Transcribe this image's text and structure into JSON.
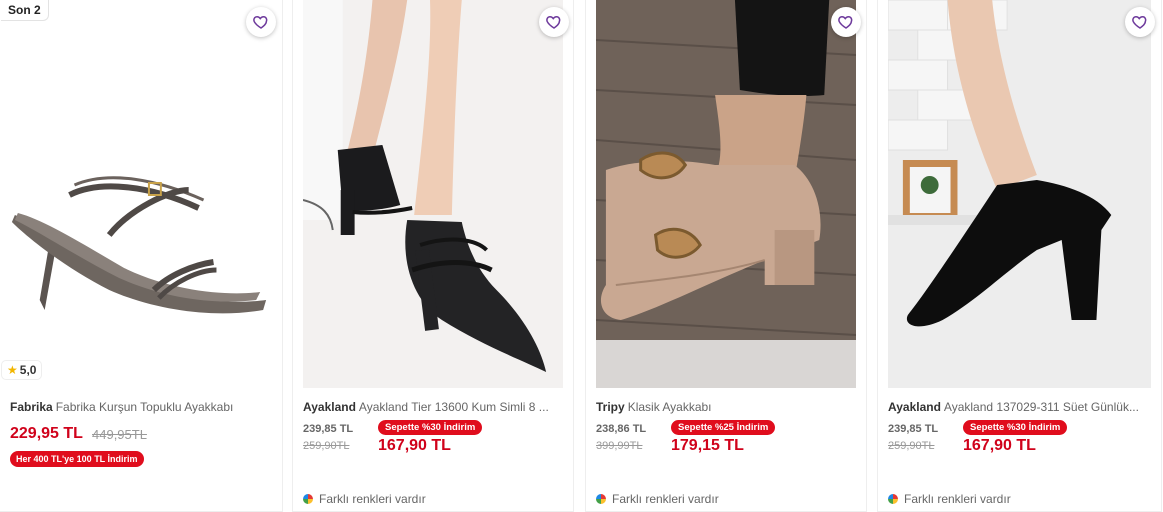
{
  "products": [
    {
      "badge": "Son 2",
      "rating": "5,0",
      "brand": "Fabrika",
      "name": "Fabrika Kurşun Topuklu Ayakkabı",
      "price": "229,95 TL",
      "old_price": "449,95TL",
      "promo": "Her 400 TL'ye 100 TL İndirim"
    },
    {
      "brand": "Ayakland",
      "name": "Ayakland Tier 13600 Kum Simli 8 ...",
      "old_price_1": "239,85 TL",
      "old_price_2": "259,90TL",
      "cart_promo": "Sepette %30 İndirim",
      "cart_price": "167,90 TL",
      "colors_note": "Farklı renkleri vardır"
    },
    {
      "brand": "Tripy",
      "name": "Klasik Ayakkabı",
      "old_price_1": "238,86 TL",
      "old_price_2": "399,99TL",
      "cart_promo": "Sepette %25 İndirim",
      "cart_price": "179,15 TL",
      "colors_note": "Farklı renkleri vardır"
    },
    {
      "brand": "Ayakland",
      "name": "Ayakland 137029-311 Süet Günlük...",
      "old_price_1": "239,85 TL",
      "old_price_2": "259,90TL",
      "cart_promo": "Sepette %30 İndirim",
      "cart_price": "167,90 TL",
      "colors_note": "Farklı renkleri vardır"
    }
  ],
  "icons": {
    "favorite": "heart-outline-icon",
    "rating": "star-icon",
    "colors": "color-wheel-icon"
  },
  "colors": {
    "price_red": "#d0021b",
    "promo_red": "#e00d1d",
    "heart_purple": "#6e3a9c"
  }
}
